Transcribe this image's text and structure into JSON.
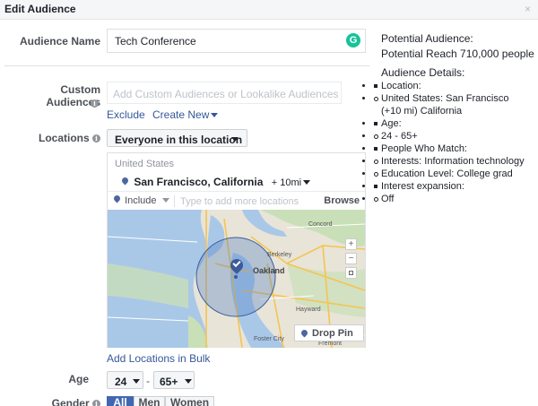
{
  "header": {
    "title": "Edit Audience",
    "close": "×"
  },
  "audience_name": {
    "label": "Audience Name",
    "value": "Tech Conference",
    "grammarly": "G"
  },
  "custom_audiences": {
    "label": "Custom Audiences",
    "placeholder": "Add Custom Audiences or Lookalike Audiences",
    "exclude": "Exclude",
    "create_new": "Create New"
  },
  "locations": {
    "label": "Locations",
    "scope": "Everyone in this location",
    "country": "United States",
    "city": "San Francisco, California",
    "radius": "+ 10mi",
    "include": "Include",
    "search_placeholder": "Type to add more locations",
    "browse": "Browse",
    "drop_pin": "Drop Pin",
    "add_bulk": "Add Locations in Bulk",
    "map_labels": {
      "concord": "Concord",
      "berkeley": "Berkeley",
      "oakland": "Oakland",
      "hayward": "Hayward",
      "foster_city": "Foster City",
      "fremont": "Fremont"
    },
    "zoom_in": "+",
    "zoom_out": "−"
  },
  "age": {
    "label": "Age",
    "min": "24",
    "max": "65+",
    "sep": "-"
  },
  "gender": {
    "label": "Gender",
    "options": [
      "All",
      "Men",
      "Women"
    ]
  },
  "potential": {
    "heading": "Potential Audience:",
    "reach": "Potential Reach 710,000 people",
    "details_heading": "Audience Details:",
    "details": [
      {
        "text": "Location:",
        "sub": false
      },
      {
        "text": "United States: San Francisco (+10 mi) California",
        "sub": true
      },
      {
        "text": "Age:",
        "sub": false
      },
      {
        "text": "24 - 65+",
        "sub": true
      },
      {
        "text": "People Who Match:",
        "sub": false
      },
      {
        "text": "Interests: Information technology",
        "sub": true
      },
      {
        "text": "Education Level: College grad",
        "sub": true
      },
      {
        "text": "Interest expansion:",
        "sub": false
      },
      {
        "text": "Off",
        "sub": true
      }
    ]
  },
  "colors": {
    "link": "#365899",
    "accent": "#4267b2",
    "map_water": "#a9c8e8"
  }
}
